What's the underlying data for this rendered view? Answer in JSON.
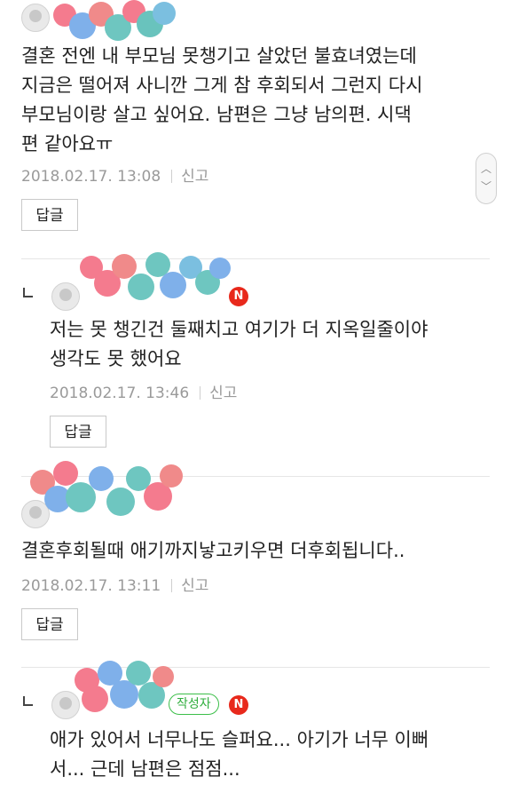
{
  "comments": [
    {
      "lines": [
        "결혼 전엔 내 부모님 못챙기고 살았던 불효녀였는데",
        "지금은 떨어져 사니깐 그게 참 후회되서 그런지 다시",
        "부모님이랑 살고 싶어요. 남편은 그냥 남의편. 시댁",
        "편 같아요ㅠ"
      ],
      "date": "2018.02.17. 13:08",
      "report": "신고",
      "reply": "답글"
    },
    {
      "badge": "N",
      "lines": [
        "저는 못 챙긴건 둘째치고 여기가 더 지옥일줄이야",
        "생각도 못 했어요"
      ],
      "date": "2018.02.17. 13:46",
      "report": "신고",
      "reply": "답글"
    },
    {
      "lines": [
        "결혼후회될때 애기까지낳고키우면 더후회됩니다.."
      ],
      "date": "2018.02.17. 13:11",
      "report": "신고",
      "reply": "답글"
    },
    {
      "author_badge": "작성자",
      "badge": "N",
      "lines": [
        "애가 있어서 너무나도 슬퍼요... 아기가 너무 이뻐",
        "서... 근데 남편은 점점..."
      ]
    }
  ],
  "scroll": {
    "up_icon": "chevron-up-icon",
    "down_icon": "chevron-down-icon"
  },
  "colors": {
    "badge_new": "#e8291c",
    "author_badge": "#2fae3d",
    "meta": "#9a9a9a"
  }
}
